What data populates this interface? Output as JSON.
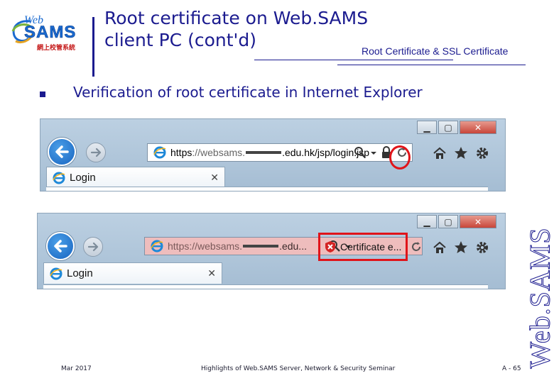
{
  "header": {
    "logo": {
      "web": "Web",
      "sams": "SAMS",
      "chinese": "網上校管系統"
    },
    "title_line1": "Root certificate on Web.SAMS",
    "title_line2": "client PC (cont'd)",
    "subtitle": "Root Certificate & SSL Certificate"
  },
  "bullet": {
    "text": "Verification of root certificate in Internet Explorer"
  },
  "browser_secure": {
    "url_scheme": "https",
    "url_prefix": "://websams.",
    "url_suffix": ".edu.hk/jsp/login.jsp",
    "tab_title": "Login",
    "lock_icon": "padlock-icon"
  },
  "browser_error": {
    "url_scheme": "https",
    "url_prefix": "://websams.",
    "url_suffix": ".edu...",
    "certificate_label": "Certificate e...",
    "tab_title": "Login",
    "error_icon": "certificate-error-icon"
  },
  "colors": {
    "title": "#1b1b8f",
    "highlight": "#e0141a",
    "error_bar": "#eebdbd",
    "back_button": "#1864c0"
  },
  "footer": {
    "date": "Mar 2017",
    "center": "Highlights of Web.SAMS Server, Network & Security Seminar",
    "page": "A - 65"
  },
  "watermark": "Web.SAMS"
}
